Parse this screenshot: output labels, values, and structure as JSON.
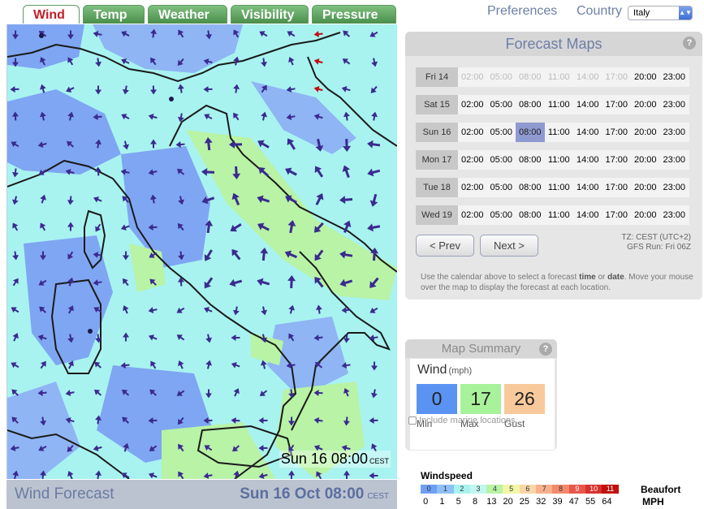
{
  "tabs": [
    {
      "label": "Wind",
      "active": true
    },
    {
      "label": "Temp",
      "active": false
    },
    {
      "label": "Weather",
      "active": false
    },
    {
      "label": "Visibility",
      "active": false
    },
    {
      "label": "Pressure",
      "active": false
    }
  ],
  "nav": {
    "preferences": "Preferences",
    "country_label": "Country",
    "country_value": "Italy"
  },
  "map": {
    "time_label": "Sun 16 08:00",
    "tz": "CEST",
    "colors": {
      "low": "#7fa6f2",
      "mid": "#a8f3f0",
      "high": "#b8f3a6",
      "arrow": "#3b2a8f",
      "strong_arrow": "#c01010"
    }
  },
  "bottom": {
    "title": "Wind Forecast",
    "date": "Sun 16 Oct 08:00",
    "tz": "CEST"
  },
  "forecast": {
    "title": "Forecast Maps",
    "help": "?",
    "days": [
      {
        "day": "Fri 14",
        "slots": [
          "02:00",
          "05:00",
          "08:00",
          "11:00",
          "14:00",
          "17:00",
          "20:00",
          "23:00"
        ],
        "past": 6,
        "selected": -1
      },
      {
        "day": "Sat 15",
        "slots": [
          "02:00",
          "05:00",
          "08:00",
          "11:00",
          "14:00",
          "17:00",
          "20:00",
          "23:00"
        ],
        "past": 0,
        "selected": -1
      },
      {
        "day": "Sun 16",
        "slots": [
          "02:00",
          "05:00",
          "08:00",
          "11:00",
          "14:00",
          "17:00",
          "20:00",
          "23:00"
        ],
        "past": 0,
        "selected": 2
      },
      {
        "day": "Mon 17",
        "slots": [
          "02:00",
          "05:00",
          "08:00",
          "11:00",
          "14:00",
          "17:00",
          "20:00",
          "23:00"
        ],
        "past": 0,
        "selected": -1
      },
      {
        "day": "Tue 18",
        "slots": [
          "02:00",
          "05:00",
          "08:00",
          "11:00",
          "14:00",
          "17:00",
          "20:00",
          "23:00"
        ],
        "past": 0,
        "selected": -1
      },
      {
        "day": "Wed 19",
        "slots": [
          "02:00",
          "05:00",
          "08:00",
          "11:00",
          "14:00",
          "17:00",
          "20:00",
          "23:00"
        ],
        "past": 0,
        "selected": -1
      }
    ],
    "prev_label": "< Prev",
    "next_label": "Next >",
    "tz_line": "TZ: CEST (UTC+2)",
    "gfs_line": "GFS Run: Fri 06Z",
    "instructions_1": "Use the calendar above to select a forecast ",
    "instructions_time": "time",
    "instructions_or": " or ",
    "instructions_date": "date",
    "instructions_2": ". Move your mouse over the map to display the forecast at each location."
  },
  "summary": {
    "title": "Map Summary",
    "help": "?",
    "label": "Wind",
    "unit": "(mph)",
    "min": "0",
    "max": "17",
    "gust": "26",
    "min_label": "Min",
    "max_label": "Max",
    "gust_label": "Gust",
    "marine_label": "Include marine locations"
  },
  "legend": {
    "title": "Windspeed",
    "beaufort_label": "Beaufort",
    "mph_label": "MPH",
    "beaufort": [
      "0",
      "1",
      "2",
      "3",
      "4",
      "5",
      "6",
      "7",
      "8",
      "9",
      "10",
      "11"
    ],
    "colors": [
      "#6f9ff3",
      "#8fc0f7",
      "#a8f3f0",
      "#c2f6ee",
      "#b8f3a6",
      "#f2f6a6",
      "#f8d6a6",
      "#f7b08c",
      "#f28a6a",
      "#e8574a",
      "#d8302c",
      "#c01010"
    ],
    "mph": [
      "0",
      "1",
      "5",
      "8",
      "13",
      "20",
      "25",
      "32",
      "39",
      "47",
      "55",
      "64"
    ]
  }
}
